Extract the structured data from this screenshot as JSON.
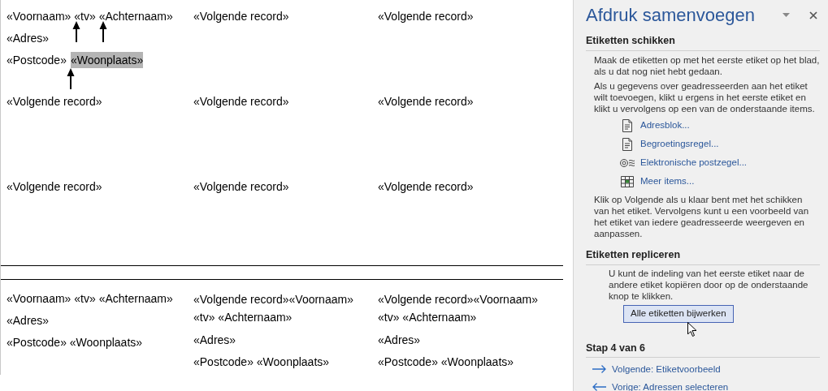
{
  "document": {
    "top_labels": [
      [
        {
          "lines": [
            "«Voornaam» «tv» «Achternaam»",
            "«Adres»",
            {
              "text": "«Postcode»",
              "selection": "«Woonplaats»"
            }
          ]
        },
        {
          "lines": [
            "«Volgende record»"
          ]
        },
        {
          "lines": [
            "«Volgende record»"
          ]
        }
      ],
      [
        {
          "lines": [
            "«Volgende record»"
          ]
        },
        {
          "lines": [
            "«Volgende record»"
          ]
        },
        {
          "lines": [
            "«Volgende record»"
          ]
        }
      ],
      [
        {
          "lines": [
            "«Volgende record»"
          ]
        },
        {
          "lines": [
            "«Volgende record»"
          ]
        },
        {
          "lines": [
            "«Volgende record»"
          ]
        }
      ]
    ],
    "bottom_labels": [
      {
        "lines": [
          "«Voornaam» «tv» «Achternaam»",
          "«Adres»",
          "«Postcode» «Woonplaats»"
        ]
      },
      {
        "lines": [
          "«Volgende record»«Voornaam» «tv» «Achternaam»",
          "«Adres»",
          "«Postcode» «Woonplaats»"
        ]
      },
      {
        "lines": [
          "«Volgende record»«Voornaam» «tv» «Achternaam»",
          "«Adres»",
          "«Postcode» «Woonplaats»"
        ]
      }
    ]
  },
  "pane": {
    "title": "Afdruk samenvoegen",
    "sections": [
      {
        "heading": "Etiketten schikken",
        "paragraphs": [
          "Maak de etiketten op met het eerste etiket op het blad, als u dat nog niet hebt gedaan.",
          "Als u gegevens over geadresseerden aan het etiket wilt toevoegen, klikt u ergens in het eerste etiket en klikt u vervolgens op een van de onderstaande items."
        ],
        "links": [
          {
            "kind": "document",
            "label": "Adresblok..."
          },
          {
            "kind": "document",
            "label": "Begroetingsregel..."
          },
          {
            "kind": "stamp",
            "label": "Elektronische postzegel..."
          },
          {
            "kind": "grid",
            "label": "Meer items..."
          }
        ],
        "after": [
          "Klik op Volgende als u klaar bent met het schikken van het etiket. Vervolgens kunt u een voorbeeld van het etiket van iedere geadresseerde weergeven en aanpassen."
        ]
      },
      {
        "heading": "Etiketten repliceren",
        "indented": [
          "U kunt de indeling van het eerste etiket naar de andere etiket kopiëren door op de onderstaande knop te klikken."
        ],
        "button": "Alle etiketten bijwerken"
      }
    ],
    "step": "Stap 4 van 6",
    "nav": [
      {
        "kind": "next",
        "label": "Volgende: Etiketvoorbeeld"
      },
      {
        "kind": "previous",
        "label": "Vorige: Adressen selecteren"
      }
    ]
  }
}
